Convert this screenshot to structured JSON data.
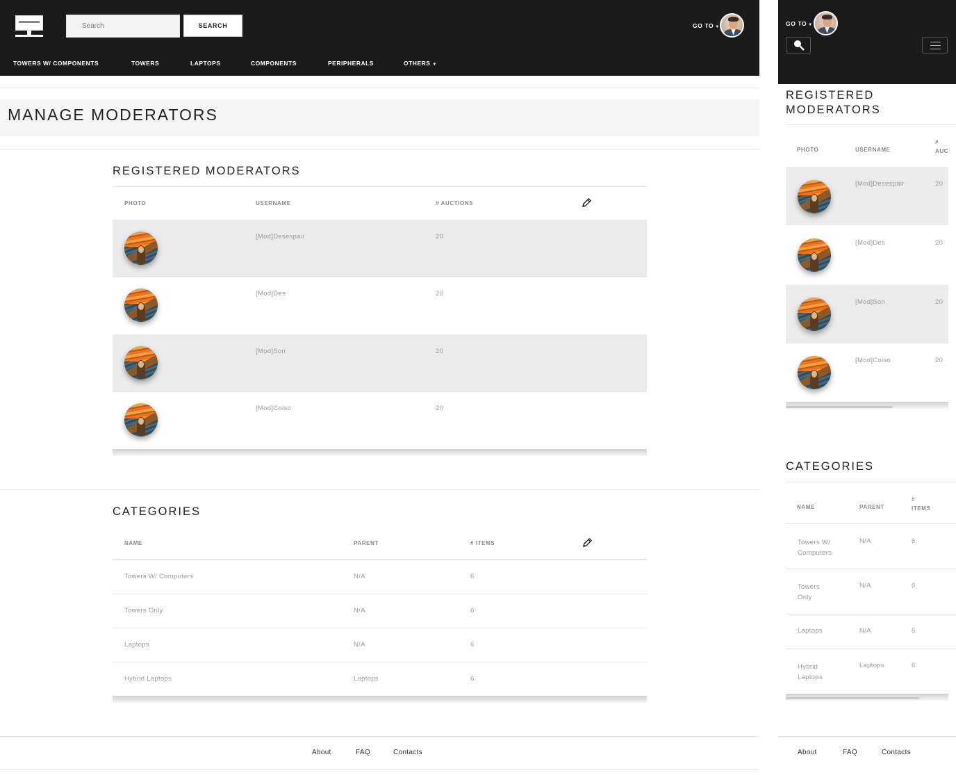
{
  "brand": {
    "logo_icon": "monitor-logo-icon"
  },
  "search": {
    "placeholder": "Search",
    "button_label": "SEARCH"
  },
  "user_menu": {
    "label": "GO TO"
  },
  "nav": {
    "items": [
      {
        "label": "TOWERS W/ COMPONENTS"
      },
      {
        "label": "TOWERS"
      },
      {
        "label": "LAPTOPS"
      },
      {
        "label": "COMPONENTS"
      },
      {
        "label": "PERIPHERALS"
      },
      {
        "label": "OTHERS"
      }
    ]
  },
  "page": {
    "title": "MANAGE MODERATORS"
  },
  "moderators": {
    "title": "REGISTERED MODERATORS",
    "mobile_title_line1": "REGISTERED",
    "mobile_title_line2": "MODERATORS",
    "headers": {
      "photo": "PHOTO",
      "username": "USERNAME",
      "auctions": "# AUCTIONS",
      "auctions_mobile_line1": "#",
      "auctions_mobile_line2": "AUC"
    },
    "rows": [
      {
        "username": "[Mod]Desespair",
        "auctions": "20"
      },
      {
        "username": "[Mod]Des",
        "auctions": "20"
      },
      {
        "username": "[Mod]Son",
        "auctions": "20"
      },
      {
        "username": "[Mod]Coiso",
        "auctions": "20"
      }
    ]
  },
  "categories": {
    "title": "CATEGORIES",
    "headers": {
      "name": "NAME",
      "parent": "PARENT",
      "items": "# ITEMS",
      "items_mobile_line1": "#",
      "items_mobile_line2": "ITEMS"
    },
    "rows": [
      {
        "name": "Towers W/ Computers",
        "name_line1": "Towers W/",
        "name_line2": "Computers",
        "parent": "N/A",
        "items": "6"
      },
      {
        "name": "Towers Only",
        "name_line1": "Towers",
        "name_line2": "Only",
        "parent": "N/A",
        "items": "6"
      },
      {
        "name": "Laptops",
        "name_line1": "Laptops",
        "name_line2": "",
        "parent": "N/A",
        "items": "6"
      },
      {
        "name": "Hybrid Laptops",
        "name_line1": "Hybrid",
        "name_line2": "Laptops",
        "parent": "Laptops",
        "items": "6"
      }
    ]
  },
  "footer": {
    "links": [
      {
        "label": "About"
      },
      {
        "label": "FAQ"
      },
      {
        "label": "Contacts"
      }
    ]
  },
  "colors": {
    "navbar": "#1b1b1b",
    "row_shaded": "#ebebeb",
    "title_band": "#f5f5f6"
  }
}
